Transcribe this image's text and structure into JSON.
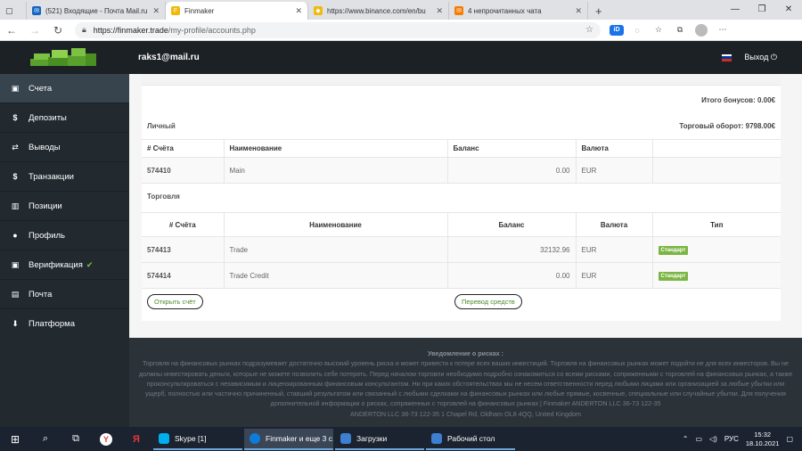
{
  "browser": {
    "tabs": [
      {
        "label": "(521) Входящие - Почта Mail.ru",
        "fav_color": "#1565c0",
        "fav_glyph": "✉"
      },
      {
        "label": "Finmaker",
        "fav_color": "#f0b90b",
        "fav_glyph": "F"
      },
      {
        "label": "https://www.binance.com/en/bu",
        "fav_color": "#f0b90b",
        "fav_glyph": "◆"
      },
      {
        "label": "4 непрочитанных чата",
        "fav_color": "#f57c00",
        "fav_glyph": "✉"
      }
    ],
    "active_tab": 1,
    "url_host": "https://finmaker.trade",
    "url_path": "/my-profile/accounts.php"
  },
  "header": {
    "user_email": "raks1@mail.ru",
    "logout_label": "Выход"
  },
  "sidebar": {
    "items": [
      {
        "label": "Счета",
        "icon": "wallet-icon",
        "glyph": "▣"
      },
      {
        "label": "Депозиты",
        "icon": "dollar-icon",
        "glyph": "$"
      },
      {
        "label": "Выводы",
        "icon": "exchange-icon",
        "glyph": "⇄"
      },
      {
        "label": "Транзакции",
        "icon": "dollar-icon",
        "glyph": "$"
      },
      {
        "label": "Позиции",
        "icon": "bar-chart-icon",
        "glyph": "▥"
      },
      {
        "label": "Профиль",
        "icon": "user-icon",
        "glyph": "●"
      },
      {
        "label": "Верификация",
        "icon": "wallet-icon",
        "glyph": "▣"
      },
      {
        "label": "Почта",
        "icon": "mail-icon",
        "glyph": "▤"
      },
      {
        "label": "Платформа",
        "icon": "download-icon",
        "glyph": "⬇"
      }
    ],
    "active_index": 0
  },
  "accounts": {
    "bonus_total": "Итого бонусов: 0.00€",
    "personal_label": "Личный",
    "turnover": "Торговый оборот: 9798.00€",
    "personal_headers": [
      "# Счёта",
      "Наименование",
      "Баланс",
      "Валюта"
    ],
    "personal_rows": [
      {
        "number": "574410",
        "name": "Main",
        "balance": "0.00",
        "currency": "EUR"
      }
    ],
    "trading_label": "Торговля",
    "trading_headers": [
      "# Счёта",
      "Наименование",
      "Баланс",
      "Валюта",
      "Тип"
    ],
    "trading_rows": [
      {
        "number": "574413",
        "name": "Trade",
        "balance": "32132.96",
        "currency": "EUR",
        "type": "Стандарт"
      },
      {
        "number": "574414",
        "name": "Trade Credit",
        "balance": "0.00",
        "currency": "EUR",
        "type": "Стандарт"
      }
    ],
    "open_account_label": "Открыть счёт",
    "transfer_label": "Перевод средств"
  },
  "footer": {
    "title": "Уведомление о рисках :",
    "text": "Торговля на финансовых рынках подразумевает достаточно высокий уровень риска и может привести к потере всех ваших инвестиций. Торговля на финансовых рынках может подойти не для всех инвесторов. Вы не должны инвестировать деньги, которые не можете позволить себе потерять. Перед началом торговли необходимо подробно ознакомиться со всеми рисками, сопряженными с торговлей на финансовых рынках, а также проконсультироваться с независимым и лицензированным финансовым консультантом. Ни при каких обстоятельствах мы не несем ответственности перед любыми лицами или организацией за любые убытки или ущерб, полностью или частично причиненный, ставший результатом или связанный с любыми сделками на финансовых рынках или любые прямые, косвенные, специальные или случайные убытки. Для получения дополнительной информации о рисках, сопряженных с торговлей на финансовых рынках | Finmaker ANDERTON LLC 36-73 122-35",
    "address": "ANDERTON LLC 36-73 122-35 1 Chapel Rd, Oldham OL8 4QQ, United Kingdom"
  },
  "taskbar": {
    "apps": [
      {
        "label": "Skype [1]",
        "color": "#00aff0"
      },
      {
        "label": "Finmaker и еще 3 с...",
        "color": "#0f7bd8"
      },
      {
        "label": "Загрузки",
        "color": "#3d7fd1"
      },
      {
        "label": "Рабочий стол",
        "color": "#3d7fd1"
      }
    ],
    "language": "РУС",
    "time": "15:32",
    "date": "18.10.2021"
  }
}
